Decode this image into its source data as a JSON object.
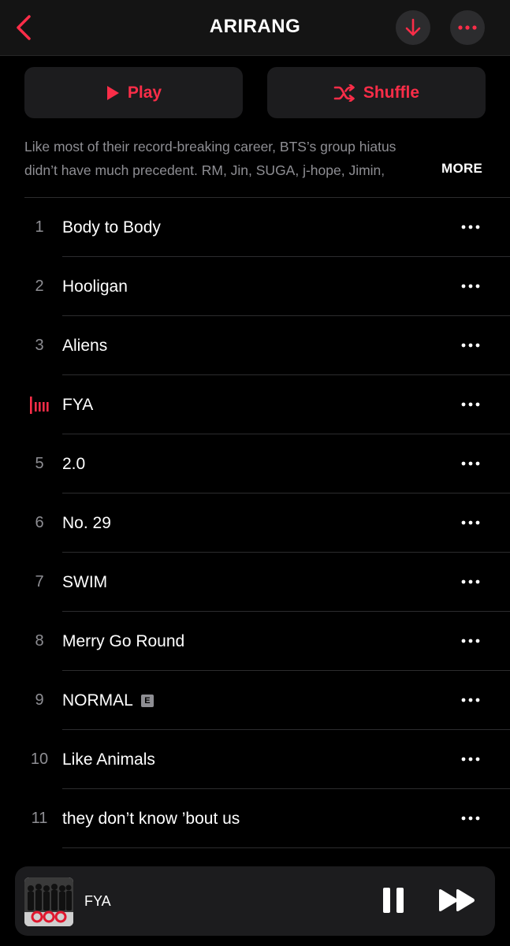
{
  "header": {
    "title": "ARIRANG"
  },
  "actions": {
    "play_label": "Play",
    "shuffle_label": "Shuffle"
  },
  "description": {
    "line1": "Like most of their record-breaking career, BTS’s group hiatus",
    "line2": "didn’t have much precedent. RM, Jin, SUGA, j-hope, Jimin,",
    "more_label": "MORE"
  },
  "tracks": [
    {
      "number": "1",
      "title": "Body to Body",
      "playing": false,
      "explicit": false
    },
    {
      "number": "2",
      "title": "Hooligan",
      "playing": false,
      "explicit": false
    },
    {
      "number": "3",
      "title": "Aliens",
      "playing": false,
      "explicit": false
    },
    {
      "number": "4",
      "title": "FYA",
      "playing": true,
      "explicit": false
    },
    {
      "number": "5",
      "title": "2.0",
      "playing": false,
      "explicit": false
    },
    {
      "number": "6",
      "title": "No. 29",
      "playing": false,
      "explicit": false
    },
    {
      "number": "7",
      "title": "SWIM",
      "playing": false,
      "explicit": false
    },
    {
      "number": "8",
      "title": "Merry Go Round",
      "playing": false,
      "explicit": false
    },
    {
      "number": "9",
      "title": "NORMAL",
      "playing": false,
      "explicit": true
    },
    {
      "number": "10",
      "title": "Like Animals",
      "playing": false,
      "explicit": false
    },
    {
      "number": "11",
      "title": "they don’t know ’bout us",
      "playing": false,
      "explicit": false
    }
  ],
  "explicit_badge": "E",
  "now_playing": {
    "title": "FYA"
  },
  "icons": {
    "back": "chevron-left-icon",
    "download": "download-arrow-icon",
    "more": "ellipsis-icon",
    "play": "play-icon",
    "shuffle": "shuffle-icon",
    "now_playing": "equalizer-bars-icon",
    "pause": "pause-icon",
    "skip": "skip-forward-icon"
  },
  "colors": {
    "accent": "#fa2d48",
    "background": "#000000",
    "surface": "#1c1c1e",
    "secondary_text": "#8e8e93"
  }
}
